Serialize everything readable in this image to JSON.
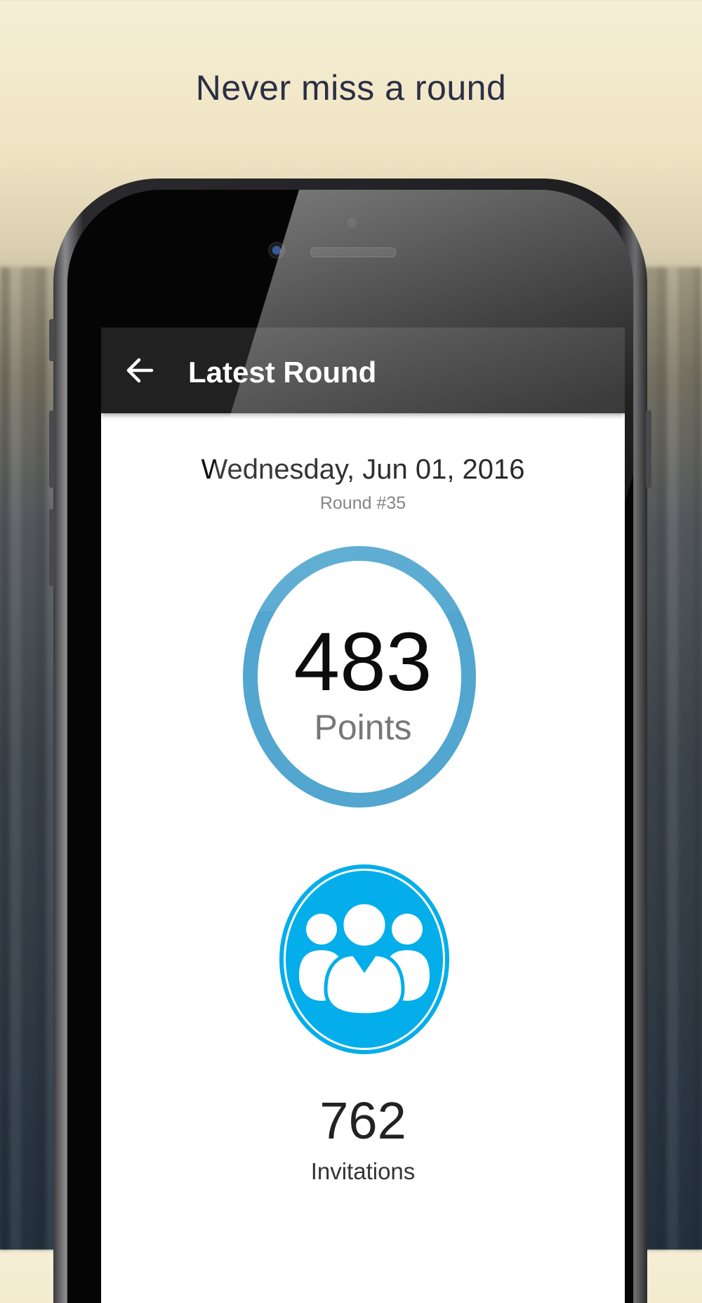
{
  "headline": "Never miss a round",
  "appbar": {
    "back_icon": "arrow-left-icon",
    "title": "Latest Round"
  },
  "round": {
    "date": "Wednesday, Jun 01, 2016",
    "number": "Round #35"
  },
  "points": {
    "value": "483",
    "label": "Points",
    "ring_color": "#52a6cf"
  },
  "invitations": {
    "icon": "group-icon",
    "icon_color": "#03aeea",
    "value": "762",
    "label": "Invitations"
  },
  "colors": {
    "appbar": "#212121",
    "screen_bg": "#ffffff"
  }
}
